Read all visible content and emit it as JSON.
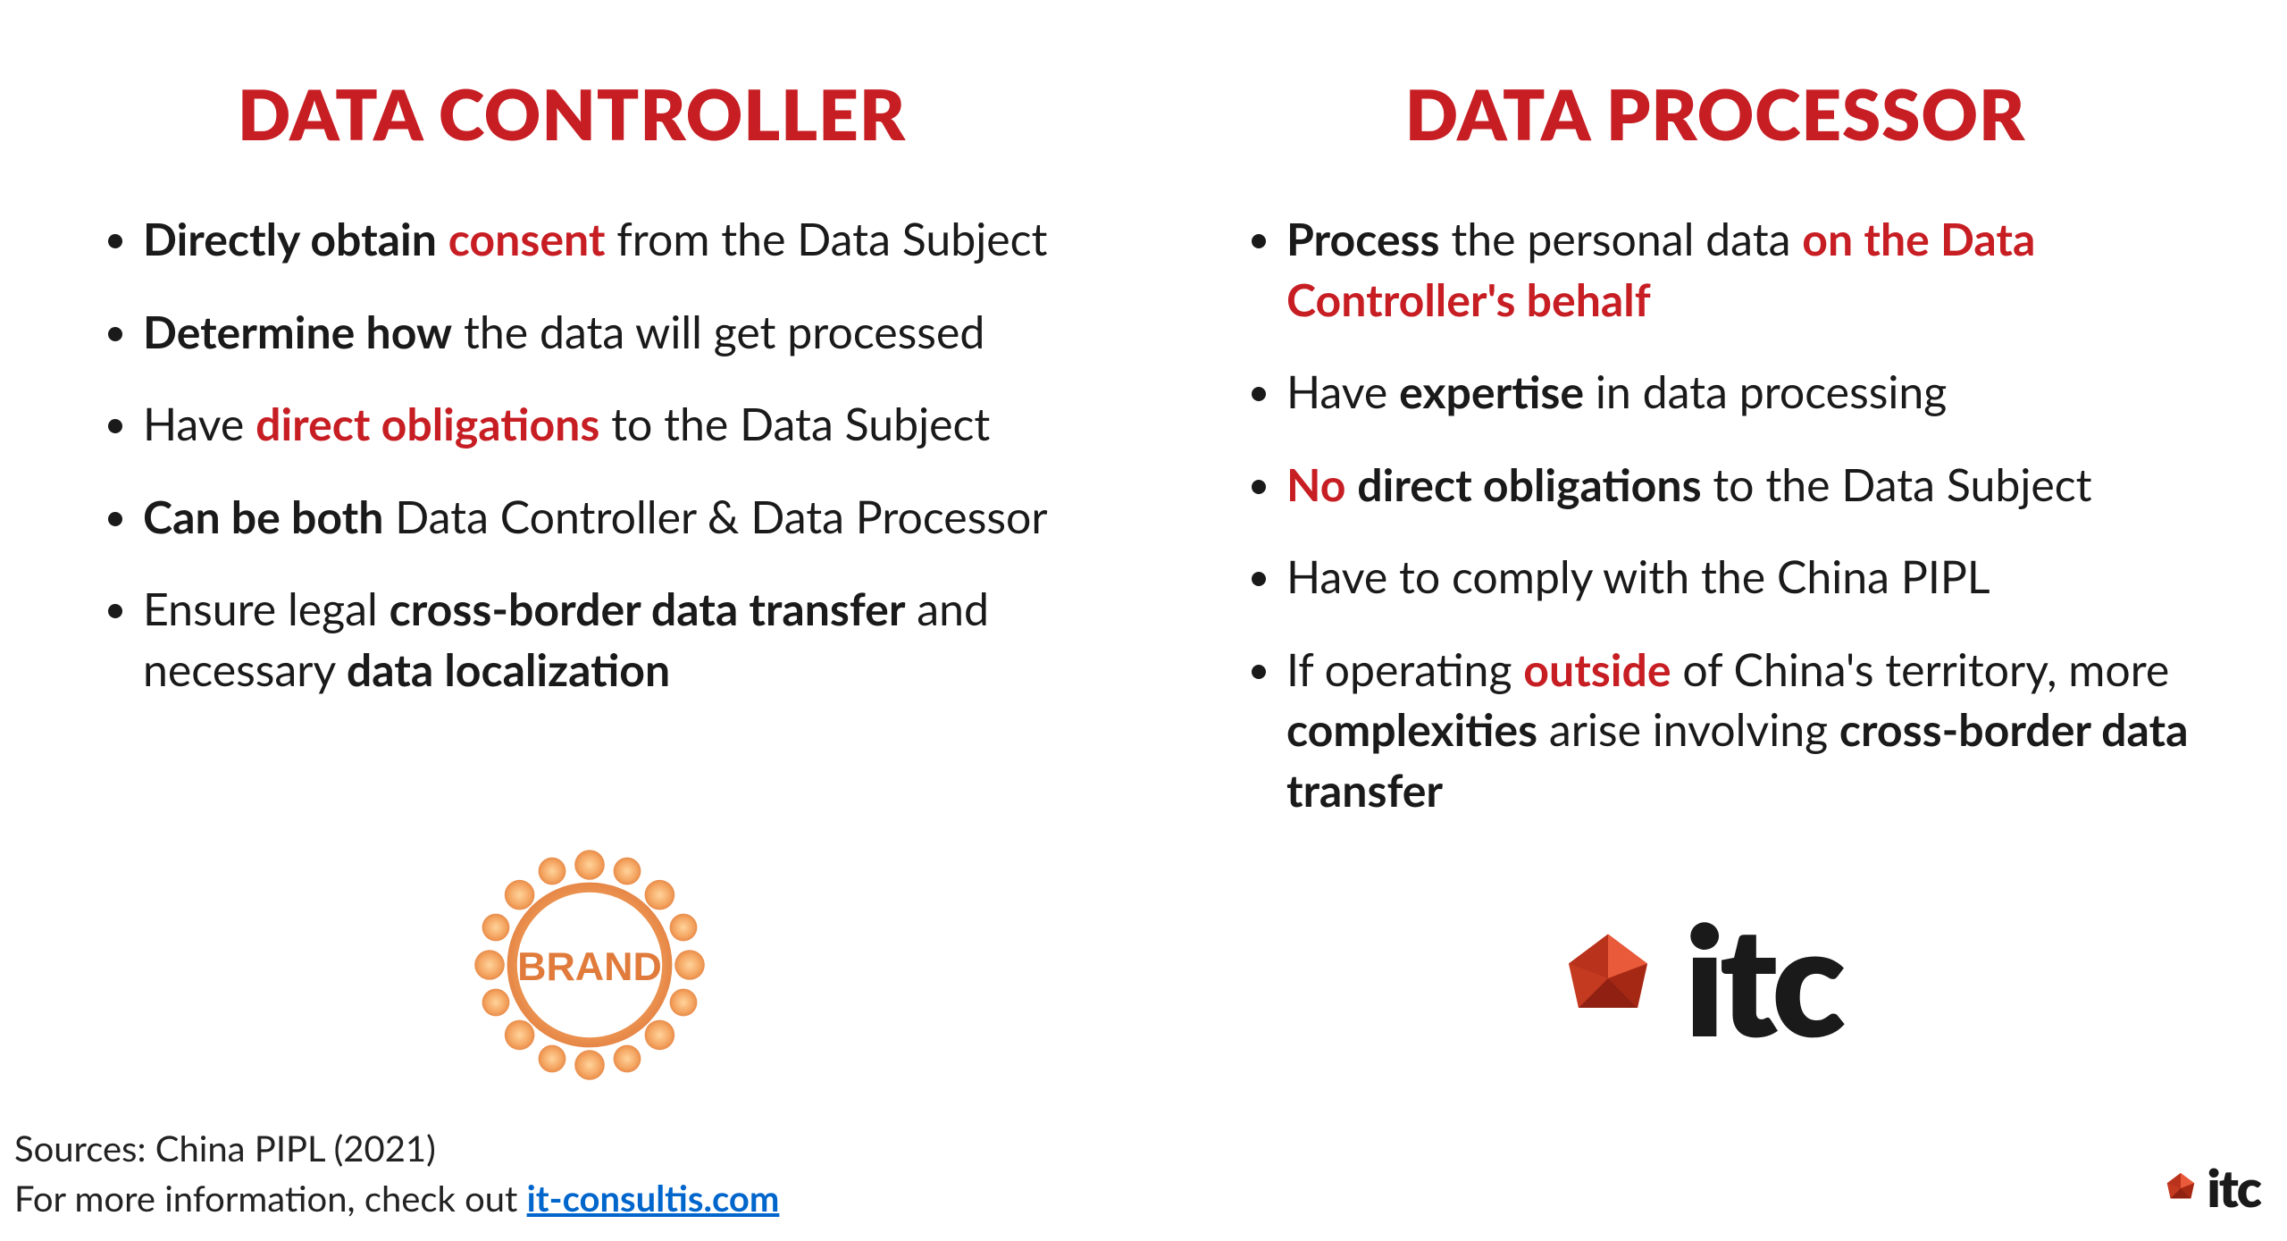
{
  "left": {
    "title": "DATA CONTROLLER",
    "bullets": [
      "<span class='b'>Directly obtain</span> <span class='r'>consent</span> from the Data Subject",
      "<span class='b'>Determine how</span> the data will get processed",
      "Have <span class='r'>direct obligations</span> to the Data Subject",
      "<span class='b'>Can be both</span> Data Controller &amp; Data Processor",
      "Ensure legal <span class='b'>cross-border data transfer</span> and necessary <span class='b'>data localization</span>"
    ]
  },
  "right": {
    "title": "DATA PROCESSOR",
    "bullets": [
      "<span class='b'>Process</span> the personal data <span class='r'>on the Data Controller's behalf</span>",
      "Have <span class='b'>expertise</span> in data processing",
      "<span class='r'>No</span> <span class='b'>direct obligations</span> to the Data Subject",
      "Have to comply with the China PIPL",
      "If operating <span class='r'>outside</span> of China's territory, more <span class='b'>complexities</span> arise involving <span class='b'>cross-border data transfer</span>"
    ]
  },
  "brand_seal_label": "BRAND",
  "itc_label": "itc",
  "footer": {
    "sources": "Sources: China PIPL (2021)",
    "more_info_prefix": "For more information, check out ",
    "link_text": "it-consultis.com"
  }
}
